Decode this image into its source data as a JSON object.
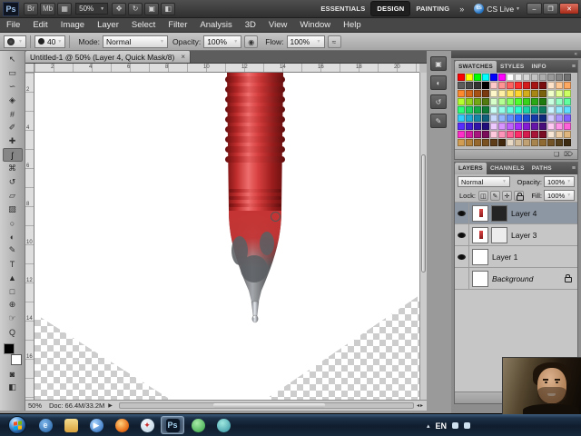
{
  "app_bar": {
    "ps_logo": "Ps",
    "zoom_value": "50%",
    "icons_left": [
      {
        "name": "launch-bridge-icon",
        "glyph": "Br"
      },
      {
        "name": "mini-bridge-icon",
        "glyph": "Mb"
      },
      {
        "name": "view-extras-icon",
        "glyph": "▦"
      }
    ],
    "icons_right": [
      {
        "name": "hand-tool-icon",
        "glyph": "✥"
      },
      {
        "name": "rotate-view-icon",
        "glyph": "↻"
      },
      {
        "name": "arrange-documents-icon",
        "glyph": "▣"
      },
      {
        "name": "screen-mode-icon",
        "glyph": "◧"
      }
    ],
    "workspaces": [
      "ESSENTIALS",
      "DESIGN",
      "PAINTING"
    ],
    "active_workspace": "DESIGN",
    "workspace_overflow": "»",
    "cs_live_label": "CS Live",
    "window_buttons": [
      {
        "name": "minimize-button",
        "glyph": "–"
      },
      {
        "name": "restore-button",
        "glyph": "❐"
      },
      {
        "name": "close-button",
        "glyph": "✕",
        "close": true
      }
    ]
  },
  "menu_bar": [
    "File",
    "Edit",
    "Image",
    "Layer",
    "Select",
    "Filter",
    "Analysis",
    "3D",
    "View",
    "Window",
    "Help"
  ],
  "options_bar": {
    "brush_size": "40",
    "mode_label": "Mode:",
    "mode_value": "Normal",
    "opacity_label": "Opacity:",
    "opacity_value": "100%",
    "flow_label": "Flow:",
    "flow_value": "100%"
  },
  "document_tab": {
    "title": "Untitled-1 @ 50% (Layer 4, Quick Mask/8)",
    "close_glyph": "×"
  },
  "rulers": {
    "top": [
      "2",
      "4",
      "6",
      "8",
      "10",
      "12",
      "14",
      "16",
      "18",
      "20"
    ],
    "left": [
      "2",
      "4",
      "6",
      "8",
      "10",
      "12",
      "14",
      "16"
    ]
  },
  "tools": [
    {
      "name": "move-tool",
      "glyph": "↖"
    },
    {
      "name": "rectangular-marquee-tool",
      "glyph": "▭"
    },
    {
      "name": "lasso-tool",
      "glyph": "∽"
    },
    {
      "name": "quick-selection-tool",
      "glyph": "◈"
    },
    {
      "name": "crop-tool",
      "glyph": "#"
    },
    {
      "name": "eyedropper-tool",
      "glyph": "✐"
    },
    {
      "name": "healing-brush-tool",
      "glyph": "✚"
    },
    {
      "name": "brush-tool",
      "glyph": "ʃ",
      "selected": true
    },
    {
      "name": "clone-stamp-tool",
      "glyph": "⌘"
    },
    {
      "name": "history-brush-tool",
      "glyph": "↺"
    },
    {
      "name": "eraser-tool",
      "glyph": "▱"
    },
    {
      "name": "gradient-tool",
      "glyph": "▨"
    },
    {
      "name": "blur-tool",
      "glyph": "○"
    },
    {
      "name": "dodge-tool",
      "glyph": "◐"
    },
    {
      "name": "pen-tool",
      "glyph": "✎"
    },
    {
      "name": "type-tool",
      "glyph": "T"
    },
    {
      "name": "path-selection-tool",
      "glyph": "▲"
    },
    {
      "name": "rectangle-tool",
      "glyph": "□"
    },
    {
      "name": "3d-rotate-tool",
      "glyph": "⊕"
    },
    {
      "name": "hand-tool",
      "glyph": "☞"
    },
    {
      "name": "zoom-tool",
      "glyph": "Q"
    }
  ],
  "toolbox_extras": [
    {
      "name": "quick-mask-icon",
      "glyph": "◙"
    },
    {
      "name": "screen-mode-toolbox-icon",
      "glyph": "◧"
    }
  ],
  "color_chips": {
    "foreground": "#000000",
    "background": "#ffffff"
  },
  "collapsed_panels": [
    {
      "name": "color-panel-icon",
      "glyph": "▣"
    },
    {
      "name": "adjustments-panel-icon",
      "glyph": "◐"
    },
    {
      "name": "history-panel-icon",
      "glyph": "↺"
    },
    {
      "name": "brush-panel-icon",
      "glyph": "✎"
    }
  ],
  "status_bar": {
    "zoom": "50%",
    "doc_info": "Doc: 66.4M/33.2M",
    "arrow": "▶"
  },
  "swatches_panel": {
    "tabs": [
      "SWATCHES",
      "STYLES",
      "INFO"
    ],
    "active_tab": "SWATCHES",
    "menu_glyph": "≡",
    "foot_icons": [
      {
        "name": "new-swatch-button",
        "glyph": "❏"
      },
      {
        "name": "delete-swatch-button",
        "glyph": "⌦"
      }
    ],
    "rows": [
      [
        "#ff0000",
        "#ffff00",
        "#00ff00",
        "#00ffff",
        "#0000ff",
        "#ff00ff",
        "#ffffff",
        "#ebebeb",
        "#d6d6d6",
        "#c2c2c2",
        "#adadad",
        "#999999",
        "#858585",
        "#707070"
      ],
      [
        "#5c5c5c",
        "#474747",
        "#333333",
        "#000000",
        "#ffc9c9",
        "#ff9494",
        "#ff6161",
        "#ff2e2e",
        "#d41c1c",
        "#a81515",
        "#7a0e0e",
        "#ffe3c9",
        "#ffc794",
        "#ffa861"
      ],
      [
        "#ff8a2e",
        "#d4691c",
        "#a85115",
        "#7a390e",
        "#fff7c9",
        "#ffefa4",
        "#ffe361",
        "#ffd52e",
        "#d4ad1c",
        "#a88715",
        "#7a610e",
        "#f0ffc9",
        "#e3ff94",
        "#ccff61"
      ],
      [
        "#b5ff2e",
        "#93d41c",
        "#73a815",
        "#527a0e",
        "#d6ffc9",
        "#b3ff94",
        "#85ff61",
        "#4fff2e",
        "#38d41c",
        "#2aa815",
        "#1d7a0e",
        "#c9ffe0",
        "#94ffc2",
        "#61ff9e"
      ],
      [
        "#2eff78",
        "#1cd45e",
        "#15a849",
        "#0e7a34",
        "#c9fff4",
        "#94ffe9",
        "#61ffdd",
        "#2effd0",
        "#1cd4aa",
        "#15a885",
        "#0e7a60",
        "#c9f4ff",
        "#94e9ff",
        "#61ddff"
      ],
      [
        "#2ed0ff",
        "#1caad4",
        "#1585a8",
        "#0e607a",
        "#c9daff",
        "#94b8ff",
        "#6192ff",
        "#2e66ff",
        "#1c4cd4",
        "#1539a8",
        "#0e277a",
        "#d1c9ff",
        "#ab94ff",
        "#8261ff"
      ],
      [
        "#572eff",
        "#401cd4",
        "#3015a8",
        "#210e7a",
        "#edc9ff",
        "#d894ff",
        "#bf61ff",
        "#a42eff",
        "#851cd4",
        "#6715a8",
        "#490e7a",
        "#ffc9f4",
        "#ff94e9",
        "#ff61da"
      ],
      [
        "#ff2ec9",
        "#d41ca3",
        "#a8157f",
        "#7a0e5a",
        "#ffc9dd",
        "#ff94bb",
        "#ff6195",
        "#ff2e6a",
        "#d41c4e",
        "#a81538",
        "#7a0e25",
        "#f7e7d4",
        "#eccfa8",
        "#dfb67d"
      ],
      [
        "#d09d52",
        "#b5823d",
        "#96682e",
        "#7a5222",
        "#5e3d18",
        "#42290e",
        "#e8d9c4",
        "#d4bd9a",
        "#bfa173",
        "#a8854f",
        "#8f6a33",
        "#735426",
        "#57401c",
        "#3d2c12"
      ]
    ]
  },
  "layers_panel": {
    "tabs": [
      "LAYERS",
      "CHANNELS",
      "PATHS"
    ],
    "active_tab": "LAYERS",
    "menu_glyph": "≡",
    "blend_mode": "Normal",
    "opacity_label": "Opacity:",
    "opacity_value": "100%",
    "lock_label": "Lock:",
    "fill_label": "Fill:",
    "fill_value": "100%",
    "lock_icons": [
      {
        "name": "lock-transparency-icon",
        "glyph": "◫"
      },
      {
        "name": "lock-paint-icon",
        "glyph": "✎"
      },
      {
        "name": "lock-position-icon",
        "glyph": "✛"
      },
      {
        "name": "lock-all-icon",
        "glyph": "css-lock"
      }
    ],
    "layers": [
      {
        "name": "Layer 4",
        "visible": true,
        "selected": true,
        "thumbs": [
          "pen",
          "dark"
        ],
        "locked": false,
        "italic": false
      },
      {
        "name": "Layer 3",
        "visible": true,
        "selected": false,
        "thumbs": [
          "pen",
          "light"
        ],
        "locked": false,
        "italic": false
      },
      {
        "name": "Layer 1",
        "visible": true,
        "selected": false,
        "thumbs": [
          "white"
        ],
        "locked": false,
        "italic": false
      },
      {
        "name": "Background",
        "visible": false,
        "selected": false,
        "thumbs": [
          "white"
        ],
        "locked": true,
        "italic": true
      }
    ],
    "footer_icons": [
      {
        "name": "link-layers-icon",
        "glyph": "∞"
      },
      {
        "name": "layer-style-icon",
        "glyph": "fx"
      },
      {
        "name": "add-layer-mask-icon",
        "glyph": "◘"
      },
      {
        "name": "adjustment-layer-icon",
        "glyph": "◑"
      },
      {
        "name": "new-group-icon",
        "glyph": "❒"
      },
      {
        "name": "new-layer-icon",
        "glyph": "❏"
      },
      {
        "name": "delete-layer-icon",
        "glyph": "⌦"
      }
    ]
  },
  "taskbar": {
    "language": "EN",
    "apps": [
      {
        "name": "internet-explorer",
        "label": "e",
        "bg": "radial-gradient(circle at 38% 32%,#7fb8ec,#1d5a9e)",
        "fg": "#e8f4ff",
        "shape": "circle"
      },
      {
        "name": "windows-explorer",
        "label": "",
        "bg": "linear-gradient(#f5dd90,#d9a33c)",
        "fg": "#7a5a10",
        "shape": "square"
      },
      {
        "name": "windows-media-player",
        "label": "▶",
        "bg": "radial-gradient(circle at 36% 32%,#a8d4ff,#1e5fb0)",
        "fg": "#ffffff",
        "shape": "circle"
      },
      {
        "name": "firefox",
        "label": "",
        "bg": "radial-gradient(circle at 40% 35%,#ffd27f,#e8701a 62%,#a84208)",
        "fg": "#ffffff",
        "shape": "circle"
      },
      {
        "name": "safari",
        "label": "✦",
        "bg": "radial-gradient(circle at 40% 32%,#f6fbff,#b4cddf)",
        "fg": "#c83030",
        "shape": "circle"
      },
      {
        "name": "photoshop",
        "label": "Ps",
        "bg": "#0b1626",
        "fg": "#a8d4f0",
        "shape": "square",
        "active": true
      },
      {
        "name": "green-app",
        "label": "",
        "bg": "radial-gradient(circle at 40% 32%,#a8eca8,#2f9f3f)",
        "fg": "#ffffff",
        "shape": "circle"
      },
      {
        "name": "teal-app",
        "label": "",
        "bg": "radial-gradient(circle at 40% 32%,#a0e8e0,#2f8f9f)",
        "fg": "#ffffff",
        "shape": "circle"
      }
    ]
  }
}
